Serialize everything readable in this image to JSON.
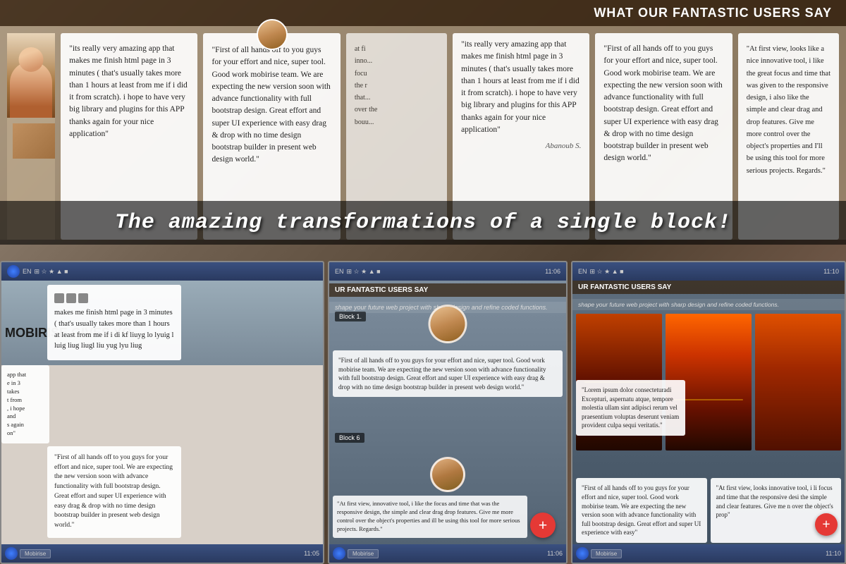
{
  "header": {
    "title": "WHAT OUR FANTASTIC USERS SAY",
    "tagline": "shape your future web project with sharp design and refine coded functions."
  },
  "overlay_title": "The amazing transformations of a single block!",
  "testimonials": [
    {
      "id": 1,
      "text": "\"its really very amazing app that makes me finish html page in 3 minutes ( that's usually takes more than 1 hours at least from me if i did it from scratch). i hope to have very big library and plugins for this APP thanks again for your nice application\"",
      "name": ""
    },
    {
      "id": 2,
      "text": "\"First of all hands off to you guys for your effort and nice, super tool. Good work mobirise team. We are expecting the new version soon with advance functionality with full bootstrap design. Great effort and super UI experience with easy drag & drop with no time design bootstrap builder in present web design world.\"",
      "name": ""
    },
    {
      "id": 3,
      "text": "\"its really very amazing app that makes me finish html page in 3 minutes ( that's usually takes more than 1 hours at least from me if i did it from scratch). i hope to have very big library and plugins for this APP thanks again for your nice application\"",
      "name": "Abanoub S."
    },
    {
      "id": 4,
      "text": "\"First of all hands off to you guys for your effort and nice, super tool. Good work mobirise team. We are expecting the new version soon with advance functionality with full bootstrap design. Great effort and super UI experience with easy drag & drop with no time design bootstrap builder in present web design world.\"",
      "name": ""
    },
    {
      "id": 5,
      "text": "\"At first view, looks like a nice innovative tool, i like the great focus and time that was given to the responsive design, i also like the simple and clear drag and drop features. Give me more control over the object's properties and I'll be using this tool for more serious projects. Regards.\"",
      "name": ""
    }
  ],
  "bottom_testimonials": [
    {
      "id": 1,
      "text": "\"First of all hands off to you guys for your effort and nice, super tool. We are expecting the new version soon with advance functionality with full bootstrap design. Great effort and super UI experience with easy drag & drop with no time design bootstrap builder in present web design world.\"",
      "name": ""
    },
    {
      "id": 2,
      "text": "\"At first view, innovative tool, i like the focus and time that was the responsive design, the simple and clear drag drop features. Give me more control over the object's properties and ill be using this tool for more serious projects. Regards.\"",
      "name": ""
    },
    {
      "id": 3,
      "text": "\"First of all hands off to you guys for your effort and nice, super tool. Good work mobirise team. We are expecting the new version soon with advance functionality with full bootstrap design. Great effort and super UI experience with easy\"",
      "name": ""
    },
    {
      "id": 4,
      "text": "\"At first view, looks innovative tool, i li focus and time that the responsive desi the simple and clear features. Give me n over the object's prop\"",
      "name": ""
    }
  ],
  "lorem_text": "\"Lorem ipsum dolor consecteturadi Excepturi, aspernatu atque, tempore molestia ullam sint adipisci rerum vel praesentium voluptas deserunt veniam provident culpa sequi veritatis.\"",
  "main_card_text": "makes me finish html page in 3 minutes ( that's usually takes more than 1 hours at least from me if i di\n\nkf liuyg lo lyuig l luig  liug  liugl liu\nyug lyu liug",
  "mobirise_text": "MOBIRISE GIVES YO",
  "block_labels": [
    "Block 1.",
    "Block 6"
  ],
  "taskbars": [
    {
      "time": "11:05",
      "lang": "EN"
    },
    {
      "time": "11:06",
      "lang": "EN"
    },
    {
      "time": "11:10",
      "lang": "EN"
    }
  ],
  "advance_functionality": "advance functionality",
  "object_properties": "the object $ properties"
}
